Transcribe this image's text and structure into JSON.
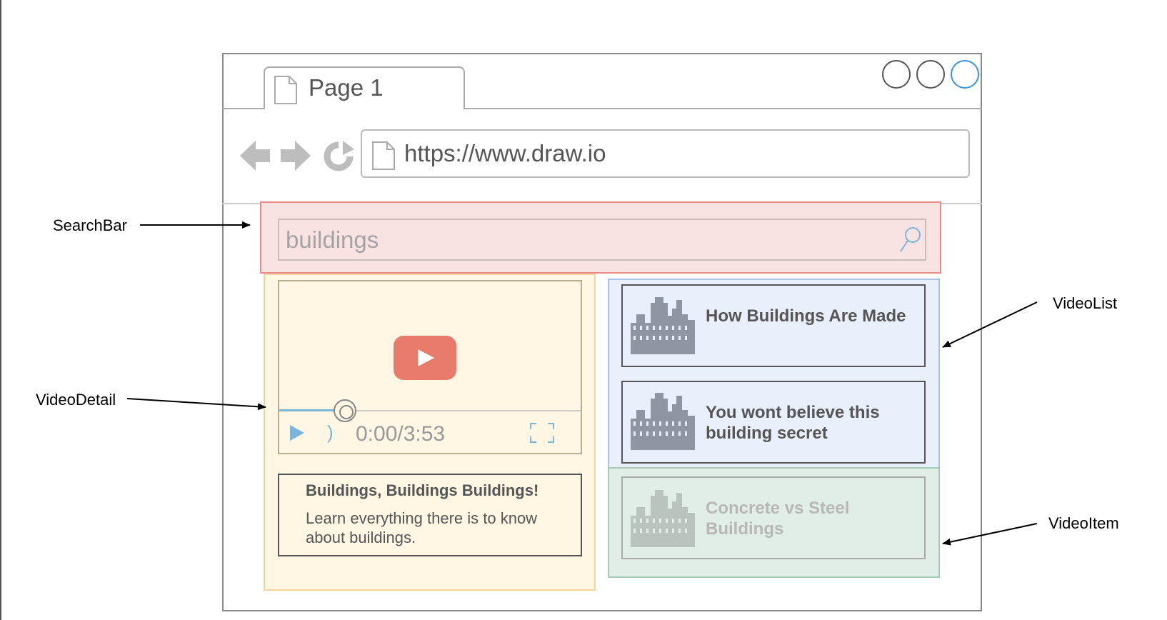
{
  "browser": {
    "tab_title": "Page 1",
    "url": "https://www.draw.io"
  },
  "search_bar": {
    "query": "buildings"
  },
  "video_detail": {
    "time": "0:00/3:53",
    "progress": 0.2,
    "title": "Buildings, Buildings Buildings!",
    "description": "Learn everything there is to know about buildings."
  },
  "video_list": {
    "items": [
      {
        "title": "How Buildings Are Made"
      },
      {
        "title": "You wont believe this building secret"
      },
      {
        "title": "Concrete vs Steel Buildings"
      }
    ]
  },
  "annotations": {
    "search_bar": "SearchBar",
    "video_detail": "VideoDetail",
    "video_list": "VideoList",
    "video_item": "VideoItem"
  },
  "colors": {
    "search_bar_fill": "#f9e2e2",
    "video_detail_fill": "#fff6e3",
    "video_list_fill": "#e9f0fb",
    "video_item_fill": "#e1eee8",
    "play_button": "#e87b6c",
    "accent_blue": "#7ab5dc"
  },
  "icons": [
    "page-icon",
    "back-arrow-icon",
    "forward-arrow-icon",
    "reload-icon",
    "search-icon",
    "play-icon",
    "volume-icon",
    "fullscreen-icon",
    "city-thumbnail-icon"
  ]
}
